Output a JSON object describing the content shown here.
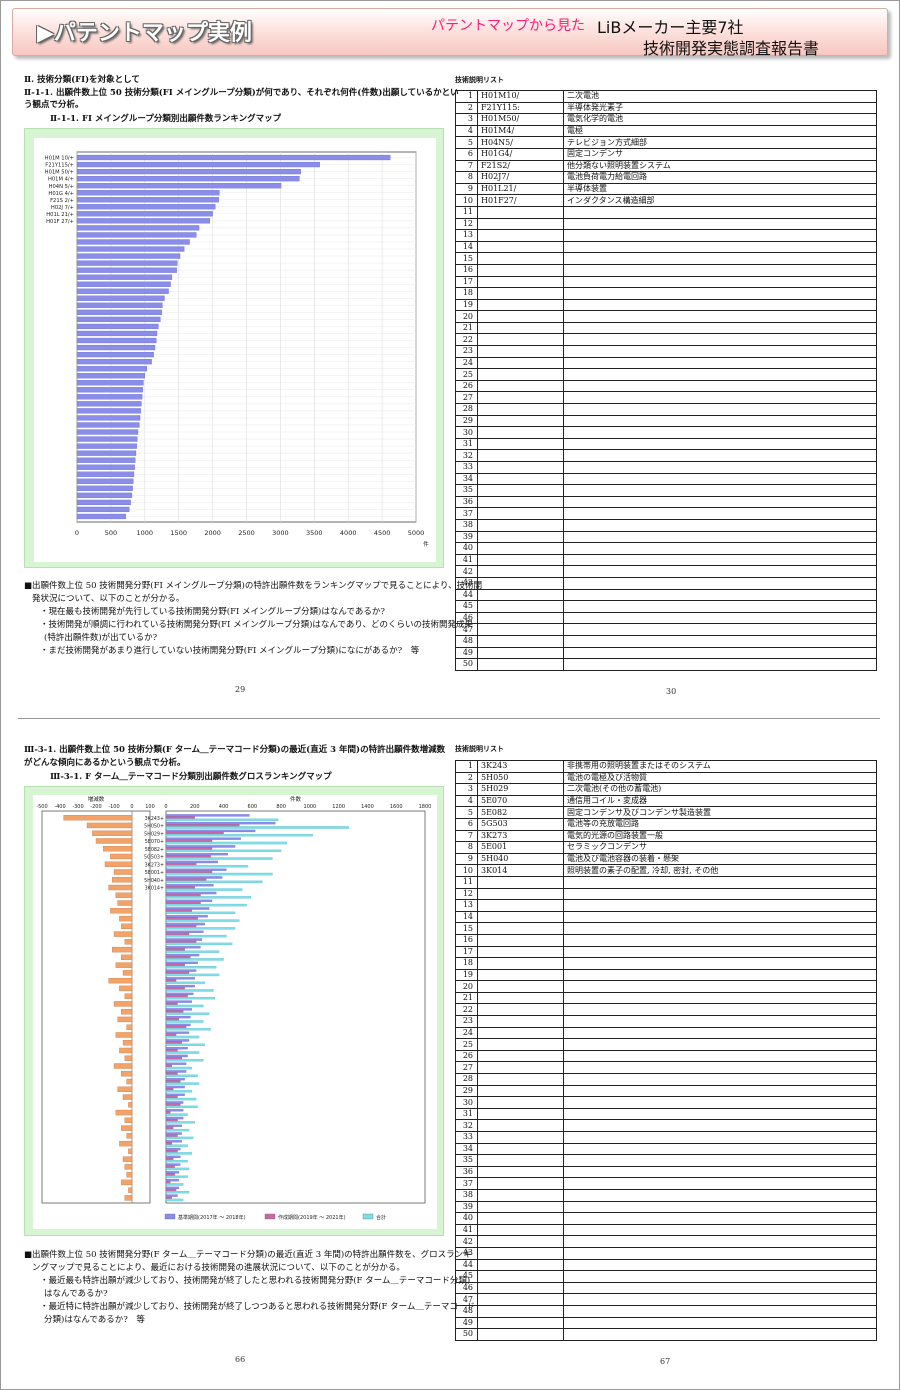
{
  "banner": {
    "title": "▶パテントマップ実例",
    "subtitle": "パテントマップから見た",
    "report_line1": "LiBメーカー主要7社",
    "report_line2": "技術開発実態調査報告書"
  },
  "page29": {
    "section": "Ⅱ. 技術分類(FI)を対象として",
    "heading": "Ⅱ-1-1. 出願件数上位 50 技術分類(FI メイングループ分類)が何であり、それぞれ何件(件数)出願しているかとい",
    "heading2": "う観点で分析。",
    "figure_title": "Ⅱ-1-1. FI メイングループ分類別出願件数ランキングマップ",
    "notes": [
      "■出願件数上位 50 技術開発分野(FI メイングループ分類)の特許出願件数をランキングマップで見ることにより、技術開",
      "発状況について、以下のことが分かる。",
      "・現在最も技術開発が先行している技術開発分野(FI メイングループ分類)はなんであるか?",
      "・技術開発が順調に行われている技術開発分野(FI メイングループ分類)はなんであり、どのくらいの技術開発成果",
      "(特許出願件数)が出ているか?",
      "・まだ技術開発があまり進行していない技術開発分野(FI メイングループ分類)になにがあるか?　等"
    ],
    "page_no": "29"
  },
  "page30": {
    "list_title": "技術説明リスト",
    "page_no": "30"
  },
  "page66": {
    "heading": "Ⅲ-3-1. 出願件数上位 50 技術分類(F ターム＿テーマコード分類)の最近(直近 3 年間)の特許出願件数増減数",
    "heading2": "がどんな傾向にあるかという観点で分析。",
    "figure_title": "Ⅲ-3-1. F ターム＿テーマコード分類別出願件数グロスランキングマップ",
    "notes": [
      "■出願件数上位 50 技術開発分野(F ターム＿テーマコード分類)の最近(直近 3 年間)の特許出願件数を、グロスランキ",
      "ングマップで見ることにより、最近における技術開発の進展状況について、以下のことが分かる。",
      "・最近最も特許出願が減少しており、技術開発が終了したと思われる技術開発分野(F ターム＿テーマコード分類)",
      "はなんであるか?",
      "・最近特に特許出願が減少しており、技術開発が終了しつつあると思われる技術開発分野(F ターム＿テーマコード",
      "分類)はなんであるか?　等"
    ],
    "page_no": "66"
  },
  "page67": {
    "list_title": "技術説明リスト",
    "page_no": "67"
  },
  "colors": {
    "bar_blue": "#8a8ee8",
    "bar_orange": "#f2a36a",
    "bar_pink": "#c86aa8",
    "bar_cyan": "#7fdde8",
    "panel_green": "#d7f4d3"
  },
  "chart_data": [
    {
      "type": "bar",
      "orientation": "horizontal",
      "title": "",
      "xlabel": "件",
      "xlim": [
        0,
        5000
      ],
      "xticks": [
        "0",
        "500",
        "1000",
        "1500",
        "2000",
        "2500",
        "3000",
        "3500",
        "4000",
        "4500",
        "5000"
      ],
      "categories": [
        "H01M 10/",
        "F21Y115/",
        "H01M 50/",
        "H01M 4/",
        "H04N 5/",
        "H01G 4/",
        "F21S 2/",
        "H02J 7/",
        "H01L 21/",
        "H01F 27/"
      ],
      "values": [
        4620,
        3580,
        3300,
        3280,
        3010,
        2100,
        2090,
        2040,
        2000,
        1960,
        1800,
        1760,
        1660,
        1580,
        1520,
        1480,
        1470,
        1400,
        1380,
        1350,
        1290,
        1260,
        1250,
        1230,
        1200,
        1180,
        1170,
        1150,
        1130,
        1100,
        1030,
        1000,
        980,
        970,
        960,
        950,
        940,
        930,
        920,
        900,
        890,
        880,
        870,
        860,
        850,
        840,
        830,
        820,
        810,
        790,
        770,
        720
      ]
    },
    {
      "type": "bar",
      "orientation": "horizontal",
      "title": "",
      "panels": [
        {
          "name": "増減数",
          "xlim": [
            -500,
            100
          ],
          "xticks": [
            "-500",
            "-400",
            "-300",
            "-200",
            "-100",
            "0",
            "100"
          ]
        },
        {
          "name": "件数",
          "xlim": [
            0,
            1800
          ],
          "xticks": [
            "0",
            "200",
            "400",
            "600",
            "800",
            "1000",
            "1200",
            "1400",
            "1600",
            "1800"
          ]
        }
      ],
      "categories": [
        "3K243",
        "5H050",
        "5H029",
        "5E070",
        "5E082",
        "5G503",
        "3K273",
        "5E001",
        "5H040",
        "3K014"
      ],
      "legend": [
        "基準期間(2017年 ～ 2018年)",
        "作成期間(2019年 ～ 2021年)",
        "合計"
      ],
      "series": [
        {
          "name": "増減数",
          "values": [
            -380,
            -250,
            -220,
            -200,
            -160,
            -120,
            -150,
            -100,
            -110,
            -130,
            -90,
            -80,
            -120,
            -70,
            -60,
            -100,
            -40,
            -110,
            -60,
            -90,
            -50,
            -130,
            -70,
            -40,
            -100,
            -60,
            -80,
            -30,
            -90,
            -50,
            -70,
            -40,
            -100,
            -60,
            -30,
            -80,
            -50,
            -20,
            -90,
            -40,
            -60,
            -30,
            -70,
            -20,
            -50,
            -40,
            -30,
            -60,
            -20,
            -40
          ]
        },
        {
          "name": "基準期間(2017年 ～ 2018年)",
          "values": [
            580,
            760,
            620,
            520,
            480,
            430,
            360,
            420,
            390,
            330,
            350,
            320,
            300,
            290,
            270,
            260,
            250,
            240,
            230,
            220,
            210,
            200,
            200,
            190,
            180,
            180,
            170,
            170,
            160,
            160,
            150,
            150,
            140,
            140,
            130,
            130,
            130,
            120,
            120,
            120,
            110,
            110,
            110,
            100,
            100,
            100,
            90,
            90,
            90,
            80
          ]
        },
        {
          "name": "作成期間(2019年 ～ 2021年)",
          "values": [
            200,
            510,
            400,
            320,
            320,
            310,
            210,
            320,
            280,
            200,
            240,
            240,
            180,
            220,
            210,
            160,
            210,
            130,
            170,
            130,
            160,
            70,
            130,
            150,
            80,
            120,
            90,
            140,
            70,
            110,
            80,
            110,
            40,
            80,
            100,
            50,
            80,
            100,
            30,
            80,
            50,
            80,
            40,
            80,
            50,
            60,
            60,
            30,
            70,
            40
          ]
        },
        {
          "name": "合計",
          "values": [
            780,
            1270,
            1020,
            840,
            800,
            740,
            570,
            740,
            670,
            530,
            590,
            560,
            480,
            510,
            480,
            420,
            460,
            370,
            400,
            350,
            370,
            270,
            330,
            340,
            260,
            300,
            260,
            310,
            230,
            270,
            230,
            260,
            180,
            220,
            230,
            180,
            210,
            220,
            150,
            200,
            160,
            190,
            150,
            180,
            150,
            160,
            150,
            120,
            160,
            120
          ]
        }
      ]
    }
  ],
  "list30": [
    [
      "1",
      "H01M10/",
      "二次電池"
    ],
    [
      "2",
      "F21Y115:",
      "半導体発光素子"
    ],
    [
      "3",
      "H01M50/",
      "電気化学的電池"
    ],
    [
      "4",
      "H01M4/",
      "電極"
    ],
    [
      "5",
      "H04N5/",
      "テレビジョン方式細部"
    ],
    [
      "6",
      "H01G4/",
      "固定コンデンサ"
    ],
    [
      "7",
      "F21S2/",
      "他分類ない照明装置システム"
    ],
    [
      "8",
      "H02J7/",
      "電池負荷電力給電回路"
    ],
    [
      "9",
      "H01L21/",
      "半導体装置"
    ],
    [
      "10",
      "H01F27/",
      "インダクタンス構造細部"
    ]
  ],
  "list67": [
    [
      "1",
      "3K243",
      "非携帯用の照明装置またはそのシステム"
    ],
    [
      "2",
      "5H050",
      "電池の電極及び活物質"
    ],
    [
      "3",
      "5H029",
      "二次電池(その他の蓄電池)"
    ],
    [
      "4",
      "5E070",
      "通信用コイル・変成器"
    ],
    [
      "5",
      "5E082",
      "固定コンデンサ及びコンデンサ製造装置"
    ],
    [
      "6",
      "5G503",
      "電池等の充放電回路"
    ],
    [
      "7",
      "3K273",
      "電気的光源の回路装置一般"
    ],
    [
      "8",
      "5E001",
      "セラミックコンデンサ"
    ],
    [
      "9",
      "5H040",
      "電池及び電池容器の装着・懸架"
    ],
    [
      "10",
      "3K014",
      "照明装置の素子の配置, 冷却, 密封, その他"
    ]
  ],
  "list_rows": [
    "1",
    "2",
    "3",
    "4",
    "5",
    "6",
    "7",
    "8",
    "9",
    "10",
    "11",
    "12",
    "13",
    "14",
    "15",
    "16",
    "17",
    "18",
    "19",
    "20",
    "21",
    "22",
    "23",
    "24",
    "25",
    "26",
    "27",
    "28",
    "29",
    "30",
    "31",
    "32",
    "33",
    "34",
    "35",
    "36",
    "37",
    "38",
    "39",
    "40",
    "41",
    "42",
    "43",
    "44",
    "45",
    "46",
    "47",
    "48",
    "49",
    "50"
  ]
}
